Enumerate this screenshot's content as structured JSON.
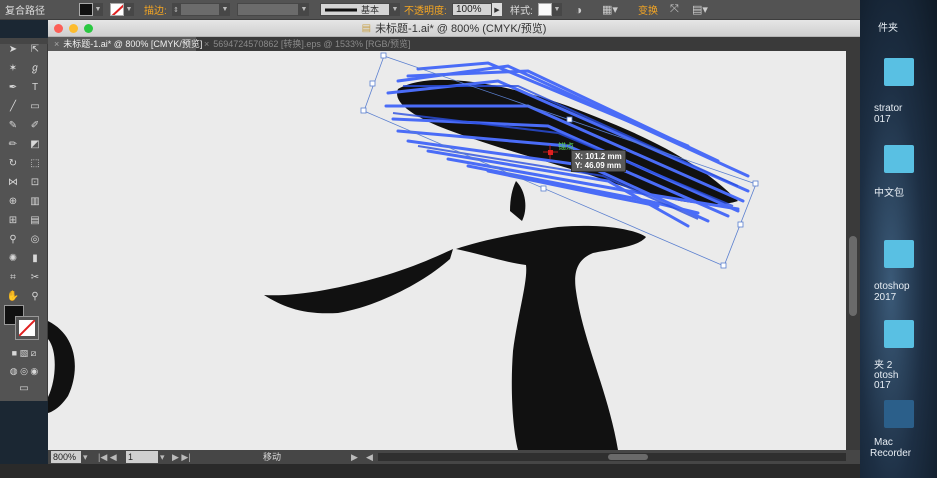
{
  "control_bar": {
    "selection_type": "复合路径",
    "stroke_label": "描边:",
    "brush_style": "基本",
    "opacity_label": "不透明度:",
    "opacity_value": "100%",
    "style_label": "样式:",
    "transform_label": "变换"
  },
  "window": {
    "title": "未标题-1.ai* @ 800% (CMYK/预览)"
  },
  "tabs": [
    {
      "label": "未标题-1.ai* @ 800% [CMYK/预览]",
      "active": true
    },
    {
      "label": "5694724570862 [转换].eps @ 1533% [RGB/预览]",
      "active": false
    }
  ],
  "tooltip": {
    "anchor": "锚点",
    "x": "X: 101.2 mm",
    "y": "Y: 46.09 mm"
  },
  "status_bar": {
    "zoom": "800%",
    "artboard": "1",
    "tool": "移动"
  },
  "desktop": {
    "labels": [
      "件夹",
      "strator",
      "017",
      "中文包",
      "otoshop",
      "2017",
      "夹 2",
      "otosh",
      "017",
      "Mac",
      "Recorder"
    ]
  },
  "colors": {
    "selection": "#4a6cf7",
    "stroke_fill": "#111111",
    "accent": "#f5a623"
  }
}
